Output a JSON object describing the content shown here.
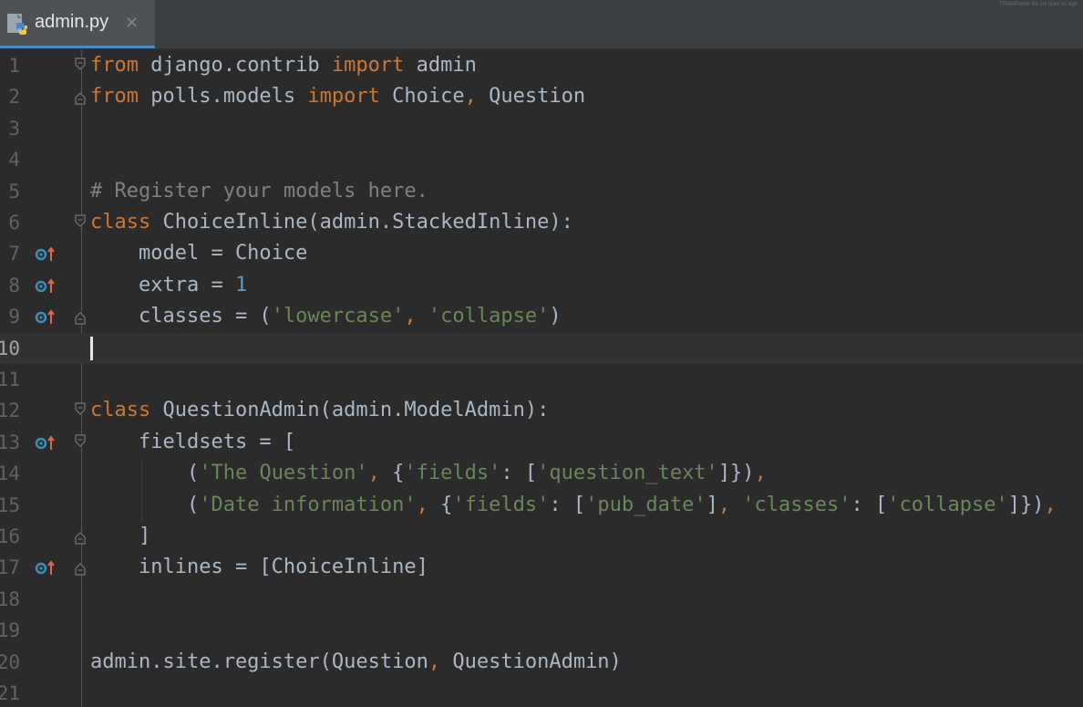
{
  "tab": {
    "filename": "admin.py",
    "close_glyph": "×",
    "icon": "python-file-icon"
  },
  "top_right_text": "TRAMPoline file set lines to sign",
  "colors": {
    "background": "#2b2b2b",
    "keyword": "#cc7832",
    "string": "#6a8759",
    "number": "#6897bb",
    "comment": "#808080",
    "text": "#a9b7c6",
    "override_icon": "#3d8fb8"
  },
  "editor": {
    "current_line": 10,
    "lines": [
      {
        "n": "1",
        "tokens": [
          [
            "kw",
            "from"
          ],
          [
            "pl",
            " django.contrib "
          ],
          [
            "kw",
            "import"
          ],
          [
            "pl",
            " admin"
          ]
        ],
        "fold": "open"
      },
      {
        "n": "2",
        "tokens": [
          [
            "kw",
            "from"
          ],
          [
            "pl",
            " polls.models "
          ],
          [
            "kw",
            "import"
          ],
          [
            "pl",
            " Choice"
          ],
          [
            "kw",
            ","
          ],
          [
            "pl",
            " Question"
          ]
        ],
        "fold": "close"
      },
      {
        "n": "3",
        "tokens": []
      },
      {
        "n": "4",
        "tokens": []
      },
      {
        "n": "5",
        "tokens": [
          [
            "cm",
            "# Register your models here."
          ]
        ]
      },
      {
        "n": "6",
        "tokens": [
          [
            "kw",
            "class"
          ],
          [
            "pl",
            " ChoiceInline(admin.StackedInline):"
          ]
        ],
        "fold": "open"
      },
      {
        "n": "7",
        "tokens": [
          [
            "pl",
            "    model = Choice"
          ]
        ],
        "override": true
      },
      {
        "n": "8",
        "tokens": [
          [
            "pl",
            "    extra = "
          ],
          [
            "num",
            "1"
          ]
        ],
        "override": true
      },
      {
        "n": "9",
        "tokens": [
          [
            "pl",
            "    classes = ("
          ],
          [
            "str",
            "'lowercase'"
          ],
          [
            "kw",
            ","
          ],
          [
            "pl",
            " "
          ],
          [
            "str",
            "'collapse'"
          ],
          [
            "pl",
            ")"
          ]
        ],
        "override": true,
        "fold": "close"
      },
      {
        "n": "10",
        "tokens": [],
        "caret": true
      },
      {
        "n": "11",
        "tokens": []
      },
      {
        "n": "12",
        "tokens": [
          [
            "kw",
            "class"
          ],
          [
            "pl",
            " QuestionAdmin(admin.ModelAdmin):"
          ]
        ],
        "fold": "open"
      },
      {
        "n": "13",
        "tokens": [
          [
            "pl",
            "    fieldsets = ["
          ]
        ],
        "override": true,
        "fold": "open"
      },
      {
        "n": "14",
        "tokens": [
          [
            "pl",
            "        ("
          ],
          [
            "str",
            "'The Question'"
          ],
          [
            "kw",
            ","
          ],
          [
            "pl",
            " {"
          ],
          [
            "str",
            "'fields'"
          ],
          [
            "pl",
            ": ["
          ],
          [
            "str",
            "'question_text'"
          ],
          [
            "pl",
            "]})"
          ],
          [
            "kw",
            ","
          ]
        ]
      },
      {
        "n": "15",
        "tokens": [
          [
            "pl",
            "        ("
          ],
          [
            "str",
            "'Date information'"
          ],
          [
            "kw",
            ","
          ],
          [
            "pl",
            " {"
          ],
          [
            "str",
            "'fields'"
          ],
          [
            "pl",
            ": ["
          ],
          [
            "str",
            "'pub_date'"
          ],
          [
            "pl",
            "]"
          ],
          [
            "kw",
            ","
          ],
          [
            "pl",
            " "
          ],
          [
            "str",
            "'classes'"
          ],
          [
            "pl",
            ": ["
          ],
          [
            "str",
            "'collapse'"
          ],
          [
            "pl",
            "]})"
          ],
          [
            "kw",
            ","
          ]
        ]
      },
      {
        "n": "16",
        "tokens": [
          [
            "pl",
            "    ]"
          ]
        ],
        "fold": "close"
      },
      {
        "n": "17",
        "tokens": [
          [
            "pl",
            "    inlines = [ChoiceInline]"
          ]
        ],
        "override": true,
        "fold": "close"
      },
      {
        "n": "18",
        "tokens": []
      },
      {
        "n": "19",
        "tokens": []
      },
      {
        "n": "20",
        "tokens": [
          [
            "pl",
            "admin.site.register(Question"
          ],
          [
            "kw",
            ","
          ],
          [
            "pl",
            " QuestionAdmin)"
          ]
        ]
      },
      {
        "n": "21",
        "tokens": []
      }
    ]
  }
}
